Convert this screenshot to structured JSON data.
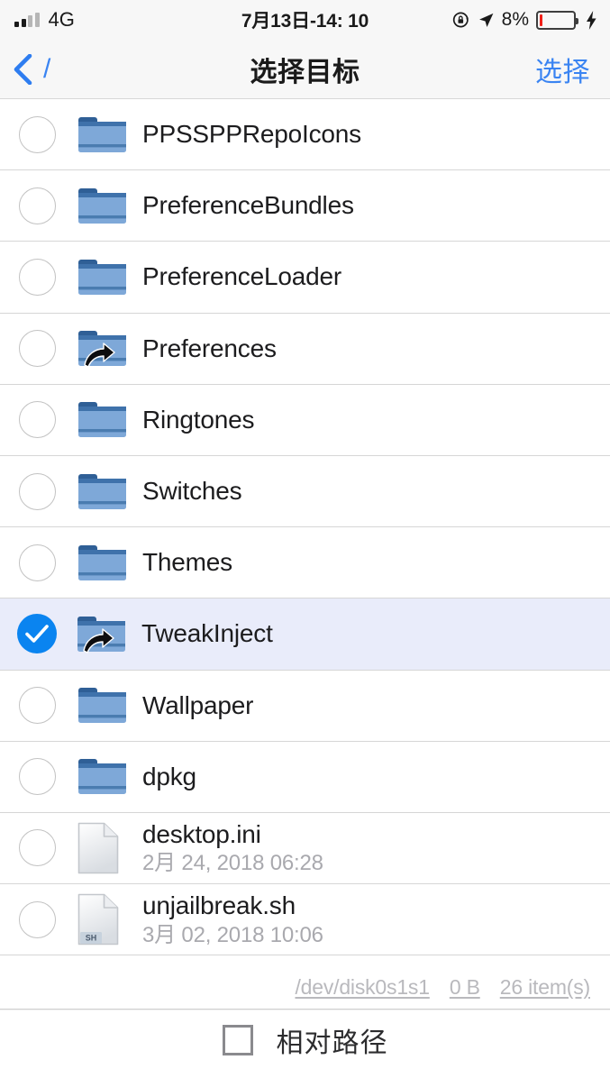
{
  "status_bar": {
    "carrier": "4G",
    "signal_bars_total": 4,
    "signal_bars_active": 2,
    "time": "7月13日-14: 10",
    "battery_percent_label": "8%",
    "battery_level": 8,
    "battery_color": "#f01f18",
    "charging": true,
    "icons": [
      "rotation-lock-icon",
      "location-arrow-icon",
      "battery-icon",
      "charging-bolt-icon"
    ]
  },
  "nav_bar": {
    "back_label": "/",
    "title": "选择目标",
    "action_label": "选择",
    "accent_color": "#3a84f2"
  },
  "list": {
    "selected_row_bg": "#e9ecfa",
    "rows": [
      {
        "name": "PPSSPPRepoIcons",
        "type": "folder",
        "symlink": false,
        "selected": false,
        "date": ""
      },
      {
        "name": "PreferenceBundles",
        "type": "folder",
        "symlink": false,
        "selected": false,
        "date": ""
      },
      {
        "name": "PreferenceLoader",
        "type": "folder",
        "symlink": false,
        "selected": false,
        "date": ""
      },
      {
        "name": "Preferences",
        "type": "folder",
        "symlink": true,
        "selected": false,
        "date": ""
      },
      {
        "name": "Ringtones",
        "type": "folder",
        "symlink": false,
        "selected": false,
        "date": ""
      },
      {
        "name": "Switches",
        "type": "folder",
        "symlink": false,
        "selected": false,
        "date": ""
      },
      {
        "name": "Themes",
        "type": "folder",
        "symlink": false,
        "selected": false,
        "date": ""
      },
      {
        "name": "TweakInject",
        "type": "folder",
        "symlink": true,
        "selected": true,
        "date": ""
      },
      {
        "name": "Wallpaper",
        "type": "folder",
        "symlink": false,
        "selected": false,
        "date": ""
      },
      {
        "name": "dpkg",
        "type": "folder",
        "symlink": false,
        "selected": false,
        "date": ""
      },
      {
        "name": "desktop.ini",
        "type": "file",
        "symlink": false,
        "selected": false,
        "date": "2月 24, 2018 06:28",
        "ext_label": ""
      },
      {
        "name": "unjailbreak.sh",
        "type": "file",
        "symlink": false,
        "selected": false,
        "date": "3月 02, 2018 10:06",
        "ext_label": "SH"
      }
    ]
  },
  "footer_stats": {
    "device": "/dev/disk0s1s1",
    "size": "0 B",
    "item_count": "26 item(s)"
  },
  "bottom_bar": {
    "relative_path_label": "相对路径",
    "relative_path_checked": false
  }
}
